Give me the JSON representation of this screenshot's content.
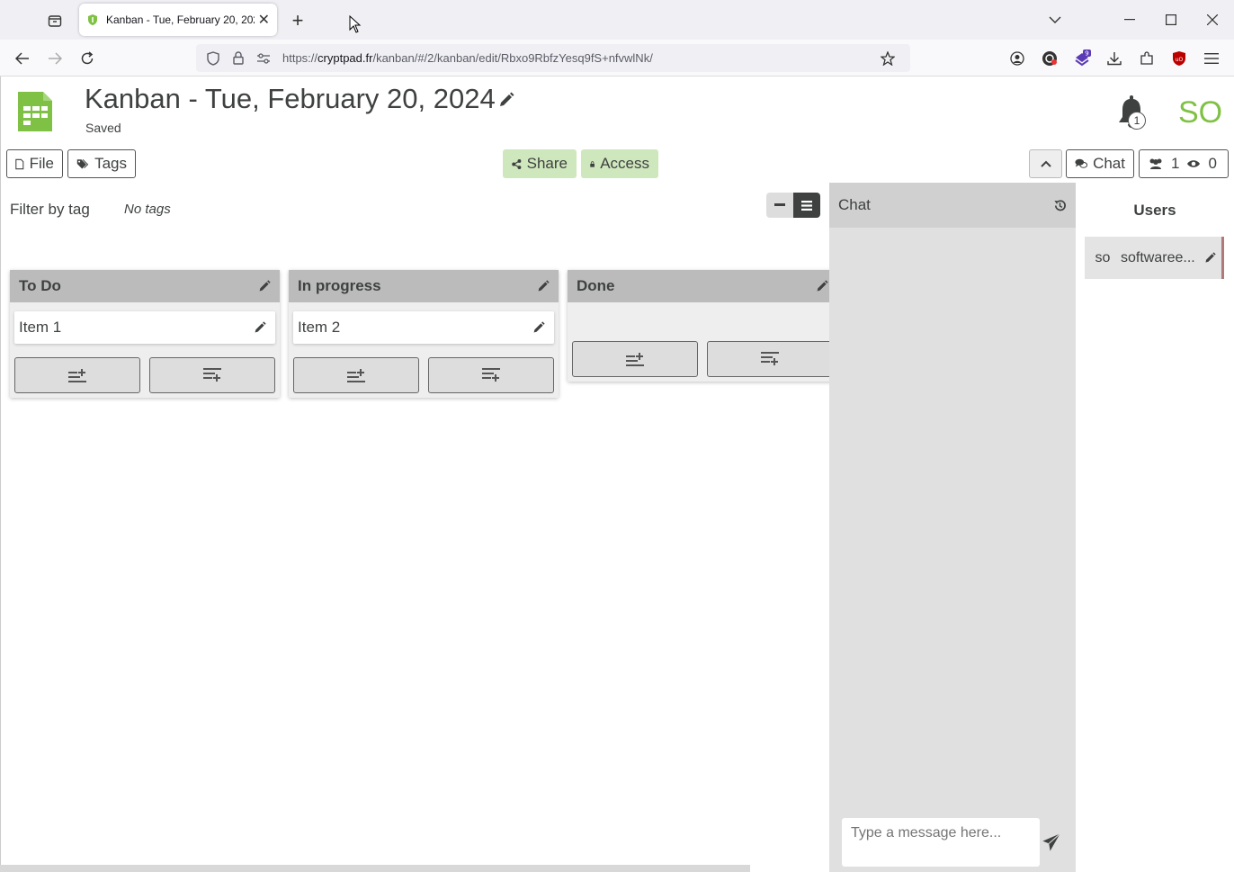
{
  "browser": {
    "tab_title": "Kanban - Tue, February 20, 2024",
    "url_prefix": "https://",
    "url_host": "cryptpad.fr",
    "url_path": "/kanban/#/2/kanban/edit/Rbxo9RbfzYesq9fS+nfvwlNk/",
    "extension_badge": "9"
  },
  "document": {
    "title": "Kanban - Tue, February 20, 2024",
    "status": "Saved"
  },
  "header": {
    "notification_count": "1",
    "user_initials": "SO"
  },
  "toolbar": {
    "file_label": "File",
    "tags_label": "Tags",
    "share_label": "Share",
    "access_label": "Access",
    "chat_label": "Chat",
    "users_count": "1",
    "viewers_count": "0"
  },
  "filter": {
    "label": "Filter by tag",
    "no_tags": "No tags"
  },
  "board": {
    "columns": [
      {
        "title": "To Do",
        "items": [
          "Item 1"
        ]
      },
      {
        "title": "In progress",
        "items": [
          "Item 2"
        ]
      },
      {
        "title": "Done",
        "items": []
      }
    ]
  },
  "chat": {
    "title": "Chat",
    "input_placeholder": "Type a message here..."
  },
  "users": {
    "title": "Users",
    "list": [
      {
        "avatar": "so",
        "name": "softwaree..."
      }
    ]
  },
  "colors": {
    "brand_green": "#7fc144",
    "action_green": "#cfe7bd",
    "column_header": "#bbbbbb",
    "text": "#3f4141"
  }
}
